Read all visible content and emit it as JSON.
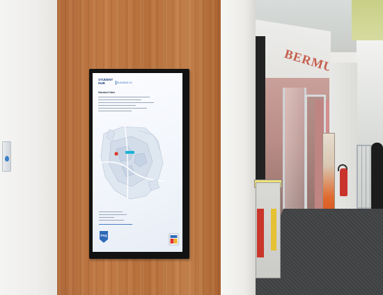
{
  "scene": {
    "description_type": "photo",
    "shop_sign_text": "BERMUDA"
  },
  "screen": {
    "hub_line1": "STUDENT",
    "hub_line2": "HUB",
    "building": "BUILDING 4X",
    "heading": "Student Hub",
    "map_marker_label": "you are here",
    "faq_label": "FAQ"
  },
  "colors": {
    "wood": "#b8723f",
    "bezel": "#121212",
    "screen_bg": "#f4f7fc",
    "map_marker_red": "#e0362a",
    "map_marker_cyan": "#19b4d6",
    "brand_blue": "#2f6ab8",
    "shop_sign": "#c55e4d"
  }
}
